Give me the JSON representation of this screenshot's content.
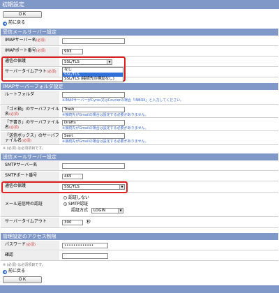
{
  "title": "初期設定",
  "buttons": {
    "ok": "ＯＫ",
    "back": "前に戻る"
  },
  "required_note": "※ (必須) は必須項目です。",
  "required_mark": "(必須)",
  "incoming": {
    "header": "受信メールサーバー設定",
    "imap_server_label": "IMAPサーバー名",
    "imap_server_value": "",
    "imap_port_label": "IMAPポート番号",
    "imap_port_value": "993",
    "security_label": "通信の保護",
    "security_value": "SSL/TLS",
    "security_options": [
      "なし",
      "SSL/TLS",
      "SSL/TLS (接続先の検証なし)"
    ],
    "security_highlight": "SSL/TLS",
    "timeout_label": "サーバータイムアウト"
  },
  "folders": {
    "header": "IMAPサーバーフォルダ設定",
    "root_label": "ルートフォルダ",
    "root_value": "",
    "root_note": "※IMAPサーバーがCyrus又はCourierの場合「INBOX」と入力してください。",
    "trash_label": "「ゴミ箱」のサーバファイル名",
    "trash_value": "Trash",
    "trash_note": "※接続先がGmailの場合は設定する必要がありません。",
    "drafts_label": "「下書き」のサーバファイル名",
    "drafts_value": "Drafts",
    "drafts_note": "※接続先がGmailの場合は設定する必要がありません。",
    "sent_label": "「送信ボックス」のサーバファイル名",
    "sent_value": "Sent",
    "sent_note": "※接続先がGmailの場合は設定する必要がありません。"
  },
  "outgoing": {
    "header": "送信メールサーバー設定",
    "smtp_server_label": "SMTPサーバー名",
    "smtp_server_value": "",
    "smtp_port_label": "SMTPポート番号",
    "smtp_port_value": "465",
    "security_label": "通信の保護",
    "security_value": "SSL/TLS",
    "auth_label": "メール送信時の認証",
    "auth_none": "認証しない",
    "auth_smtp": "SMTP認証",
    "auth_method_label": "認証方式",
    "auth_method_value": "LOGIN",
    "timeout_label": "サーバータイムアウト",
    "timeout_value": "300",
    "timeout_unit": "秒"
  },
  "admin": {
    "header": "管理設定のアクセス制限",
    "password_label": "パスワード",
    "password_value": "•••••••••••••",
    "confirm_label": "確認",
    "confirm_value": ""
  },
  "colors": {
    "header_bg": "#8098c8",
    "highlight_box": "#e02020",
    "note_text": "#3a66d0"
  }
}
